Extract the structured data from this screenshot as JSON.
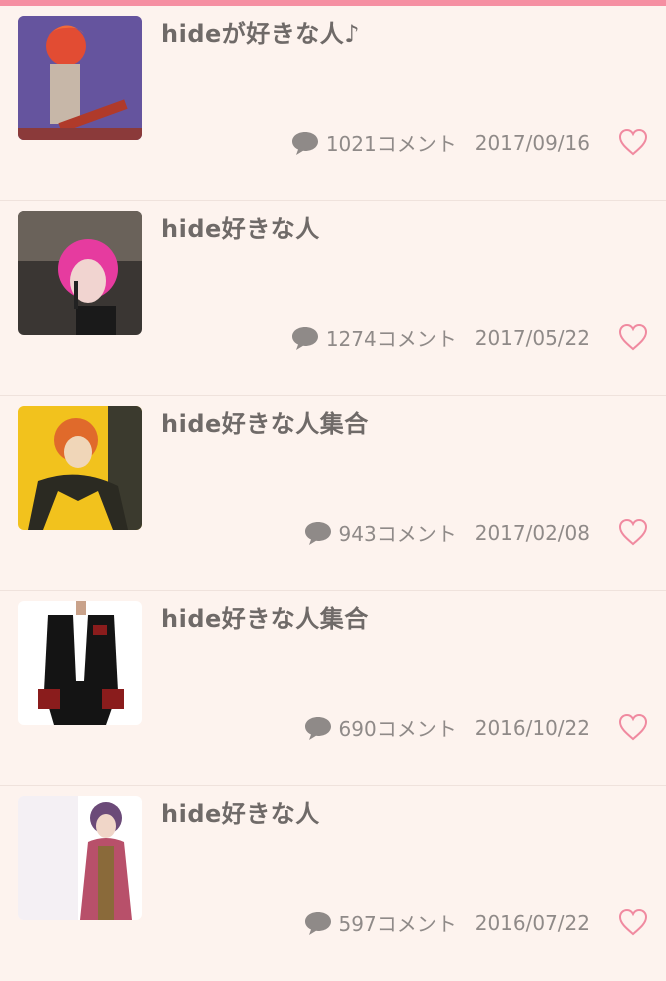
{
  "header": {
    "accent_color": "#f58fa2"
  },
  "threads": [
    {
      "title": "hideが好きな人♪",
      "comments": "1021コメント",
      "date": "2017/09/16",
      "thumb_colors": [
        "#5b4d8f",
        "#e24c33",
        "#c7b7a8"
      ],
      "icon": "favorite-heart-icon"
    },
    {
      "title": "hide好きな人",
      "comments": "1274コメント",
      "date": "2017/05/22",
      "thumb_colors": [
        "#3a3633",
        "#e63b9f",
        "#f1d4d0"
      ],
      "icon": "favorite-heart-icon"
    },
    {
      "title": "hide好きな人集合",
      "comments": "943コメント",
      "date": "2017/02/08",
      "thumb_colors": [
        "#f2c21d",
        "#e06a2b",
        "#3b3a2e"
      ],
      "icon": "favorite-heart-icon"
    },
    {
      "title": "hide好きな人集合",
      "comments": "690コメント",
      "date": "2016/10/22",
      "thumb_colors": [
        "#ffffff",
        "#141414",
        "#8a1c1c"
      ],
      "icon": "favorite-heart-icon"
    },
    {
      "title": "hide好きな人",
      "comments": "597コメント",
      "date": "2016/07/22",
      "thumb_colors": [
        "#ffffff",
        "#b8506a",
        "#8a6a3a"
      ],
      "icon": "favorite-heart-icon"
    }
  ]
}
